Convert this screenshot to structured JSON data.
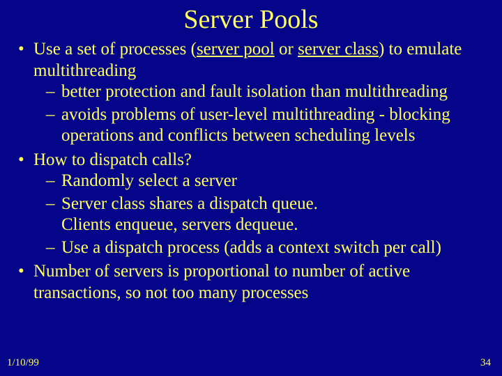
{
  "title": "Server Pools",
  "bullets": {
    "b1": {
      "pre": "Use a set of processes (",
      "u1": "server pool",
      "mid": " or ",
      "u2": "server class",
      "post": ") to emulate multithreading",
      "sub1": "better protection and fault isolation than multithreading",
      "sub2": "avoids problems of user-level multithreading - blocking operations and conflicts between scheduling levels"
    },
    "b2": {
      "text": "How to dispatch calls?",
      "sub1": "Randomly select a server",
      "sub2a": "Server class shares a dispatch queue.",
      "sub2b": "Clients enqueue, servers dequeue.",
      "sub3": "Use a dispatch process (adds a context switch per call)"
    },
    "b3": {
      "text": "Number of servers is proportional to number of active transactions, so not too many processes"
    }
  },
  "footer": {
    "date": "1/10/99",
    "page": "34"
  }
}
